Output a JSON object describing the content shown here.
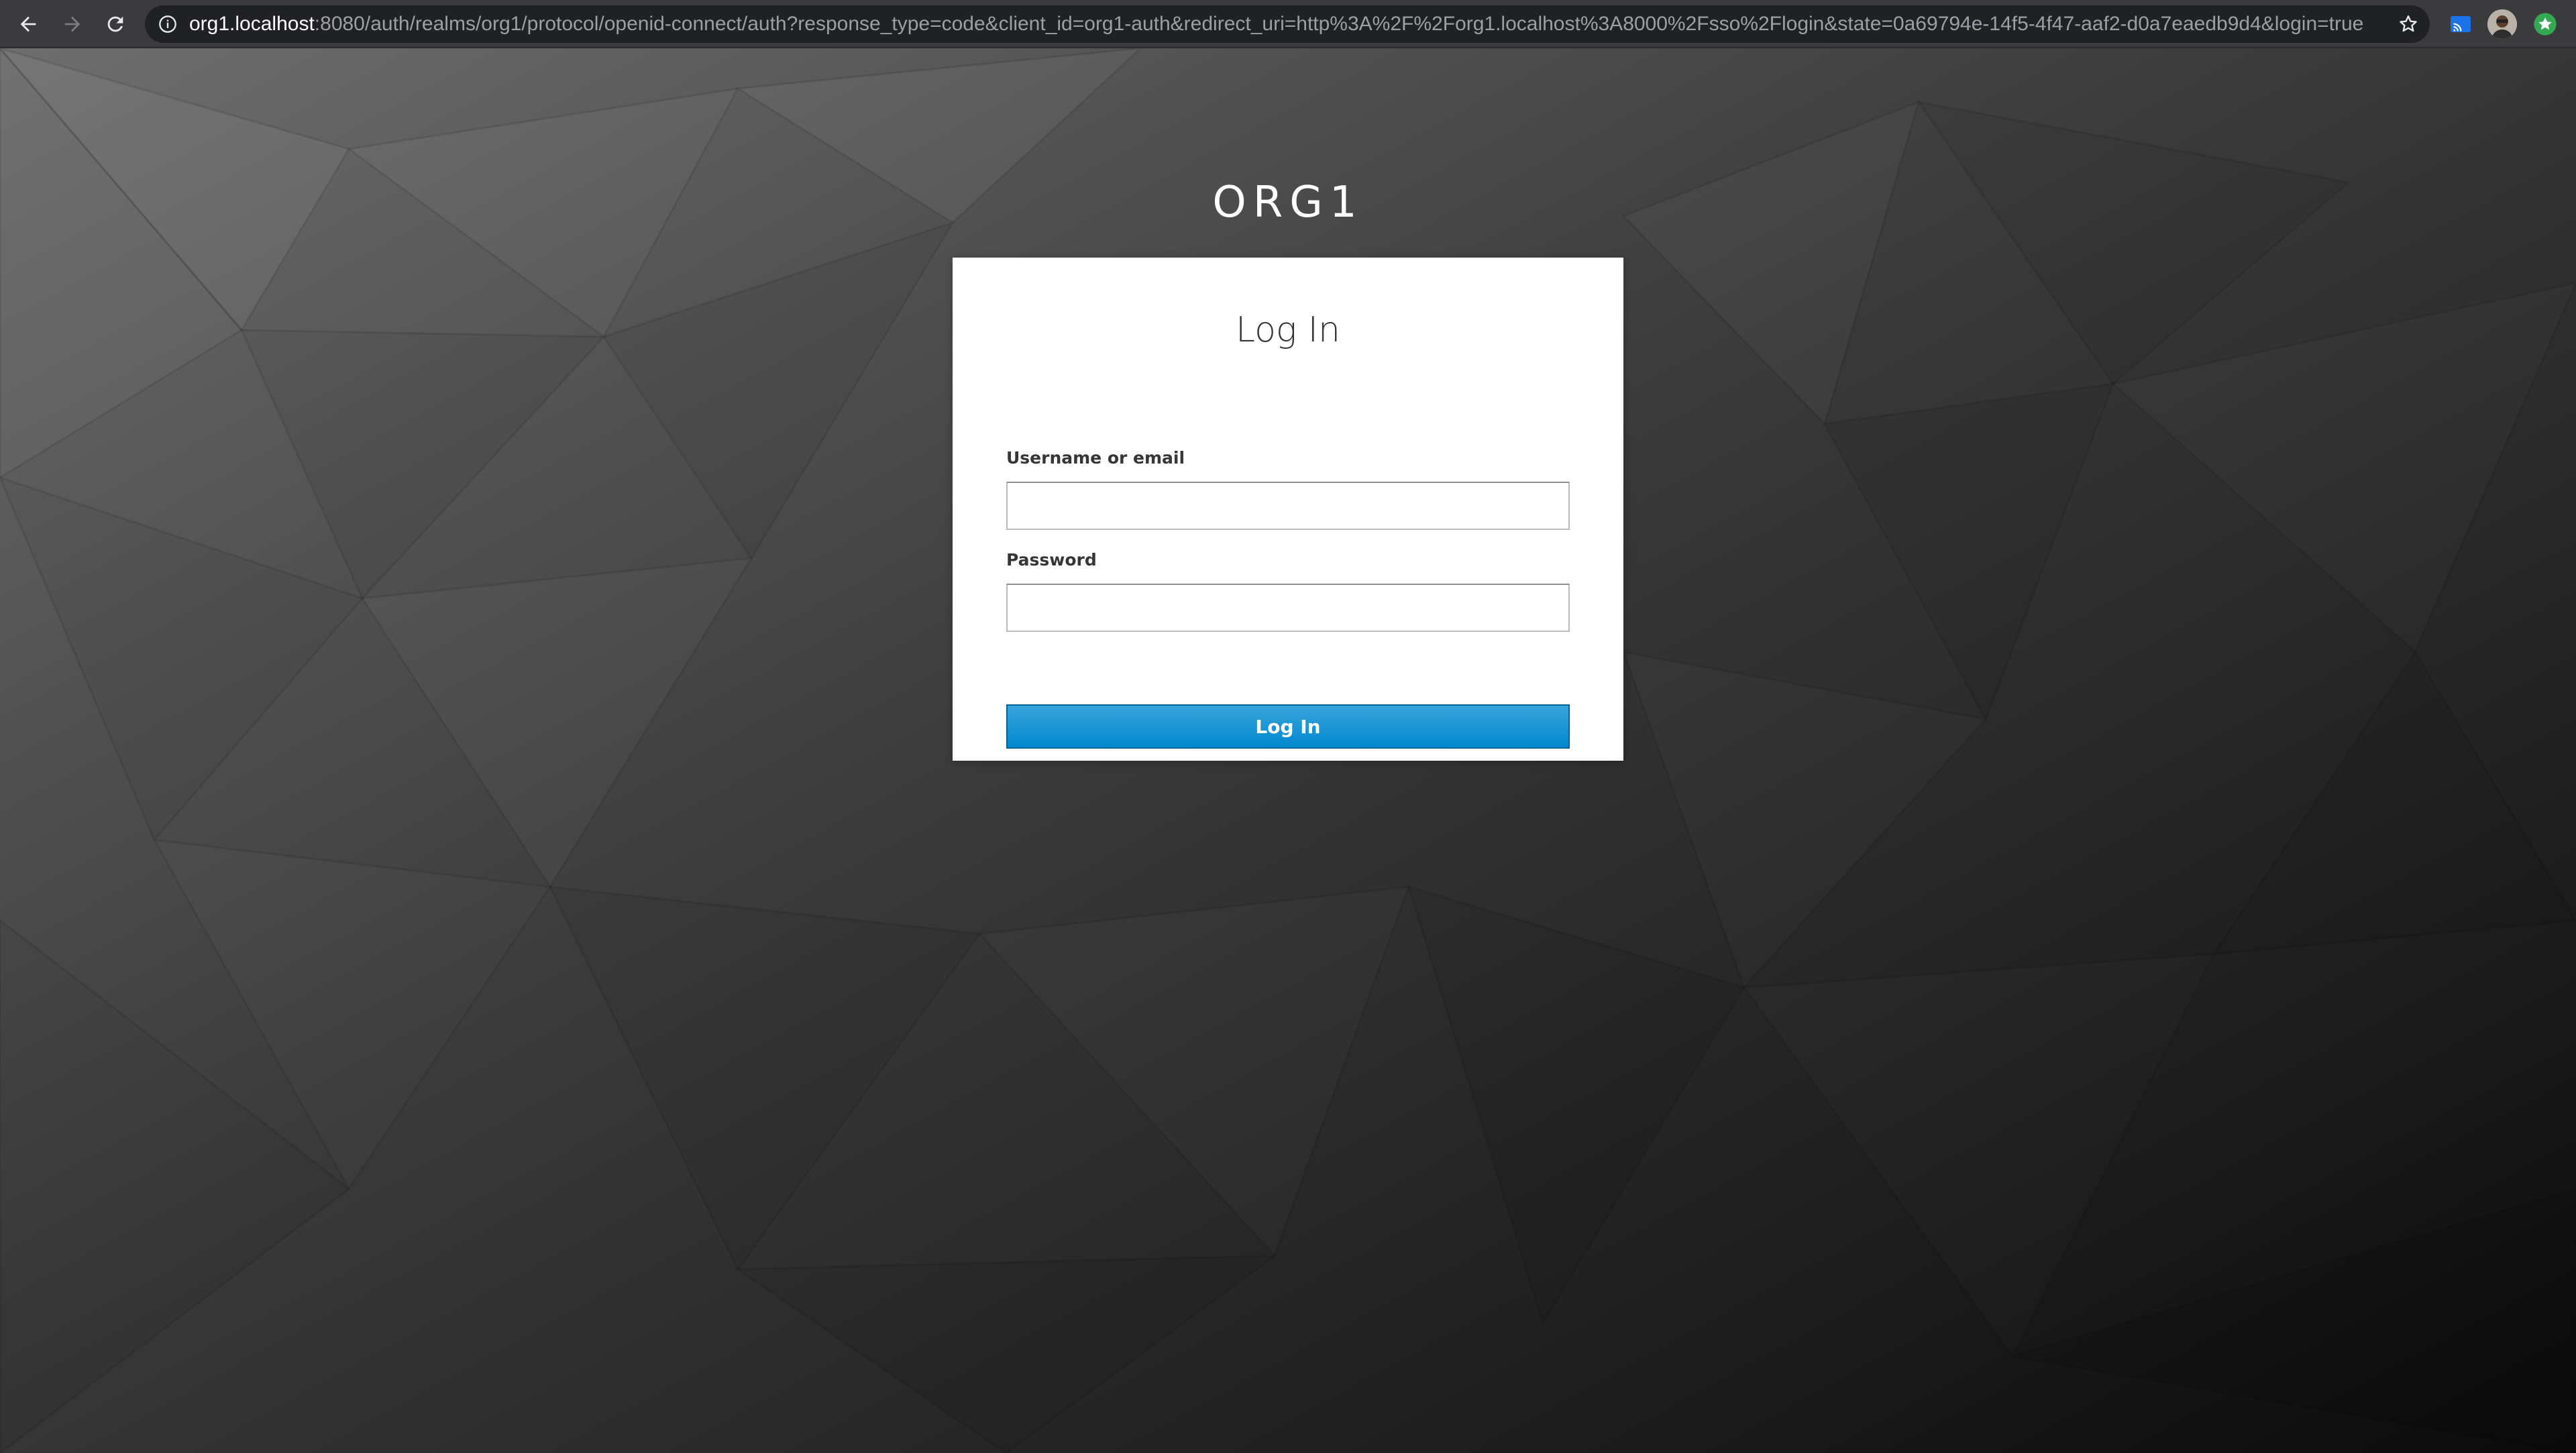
{
  "browser": {
    "url_host": "org1.localhost",
    "url_rest": ":8080/auth/realms/org1/protocol/openid-connect/auth?response_type=code&client_id=org1-auth&redirect_uri=http%3A%2F%2Forg1.localhost%3A8000%2Fsso%2Flogin&state=0a69794e-14f5-4f47-aaf2-d0a7eaedb9d4&login=true&scope=op...",
    "icons": [
      "back-arrow-icon",
      "forward-arrow-icon",
      "reload-icon",
      "info-icon",
      "star-icon",
      "cast-icon",
      "avatar",
      "extension-icon"
    ]
  },
  "page": {
    "realm_name": "ORG1",
    "card": {
      "title": "Log In",
      "username_label": "Username or email",
      "username_value": "",
      "password_label": "Password",
      "password_value": "",
      "submit_label": "Log In"
    }
  },
  "colors": {
    "primary_button": "#0088ce",
    "background_light": "#6e6e6e",
    "background_dark": "#0b0b0b"
  }
}
